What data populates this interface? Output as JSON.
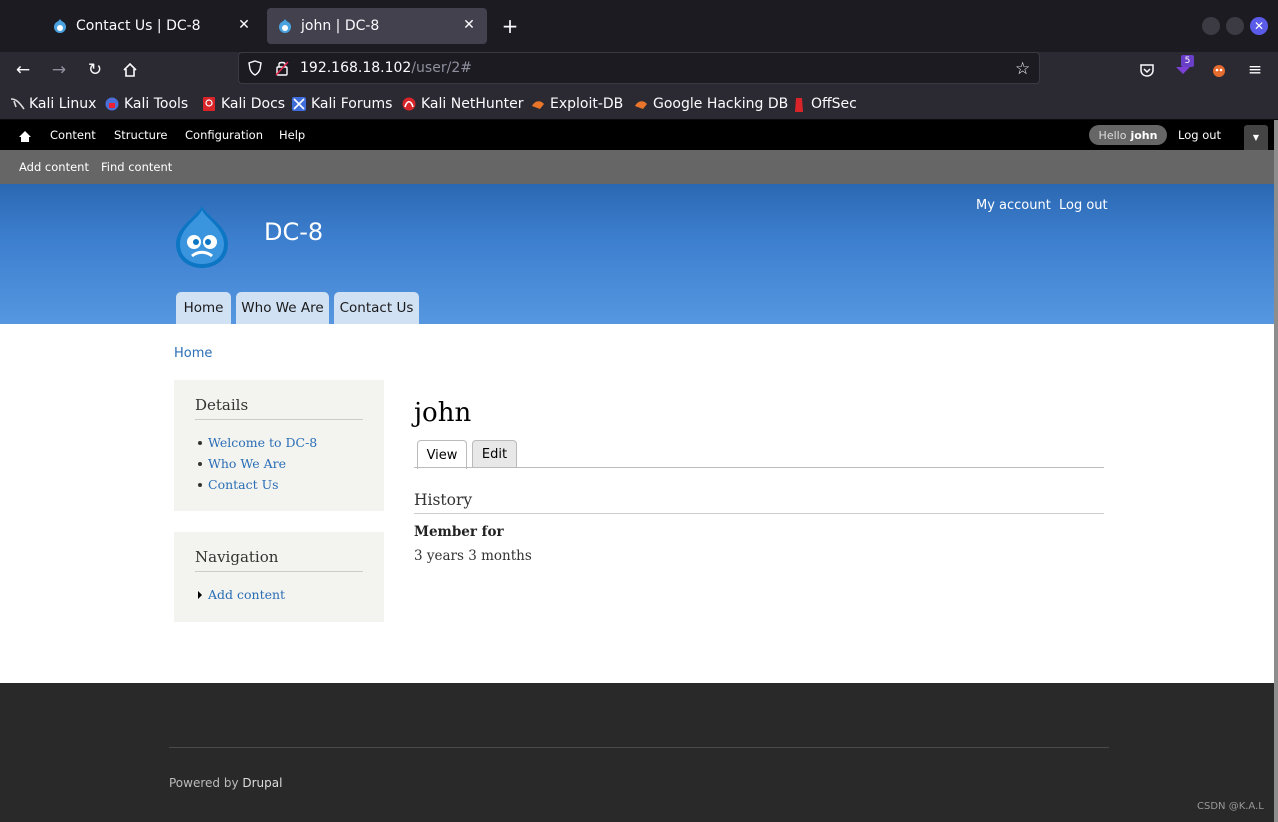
{
  "browser": {
    "tabs": [
      {
        "title": "Contact Us | DC-8"
      },
      {
        "title": "john | DC-8"
      }
    ],
    "url": {
      "host": "192.168.18.102",
      "path": "/user/2#"
    },
    "ext_badge": "5",
    "bookmarks": [
      {
        "label": "Kali Linux"
      },
      {
        "label": "Kali Tools"
      },
      {
        "label": "Kali Docs"
      },
      {
        "label": "Kali Forums"
      },
      {
        "label": "Kali NetHunter"
      },
      {
        "label": "Exploit-DB"
      },
      {
        "label": "Google Hacking DB"
      },
      {
        "label": "OffSec"
      }
    ]
  },
  "admin": {
    "menu": [
      "Content",
      "Structure",
      "Configuration",
      "Help"
    ],
    "hello": "Hello",
    "user": "john",
    "logout": "Log out",
    "shortcuts": [
      "Add content",
      "Find content"
    ]
  },
  "site": {
    "name": "DC-8",
    "secondary": [
      "My account",
      "Log out"
    ],
    "primary": [
      "Home",
      "Who We Are",
      "Contact Us"
    ]
  },
  "breadcrumb": "Home",
  "sidebar": {
    "details": {
      "title": "Details",
      "items": [
        "Welcome to DC-8",
        "Who We Are",
        "Contact Us"
      ]
    },
    "navigation": {
      "title": "Navigation",
      "items": [
        "Add content"
      ]
    }
  },
  "content": {
    "title": "john",
    "tabs": [
      "View",
      "Edit"
    ],
    "section": "History",
    "member_label": "Member for",
    "member_value": "3 years 3 months"
  },
  "footer": {
    "powered_prefix": "Powered by ",
    "powered_link": "Drupal"
  },
  "watermark": "CSDN @K.A.L"
}
